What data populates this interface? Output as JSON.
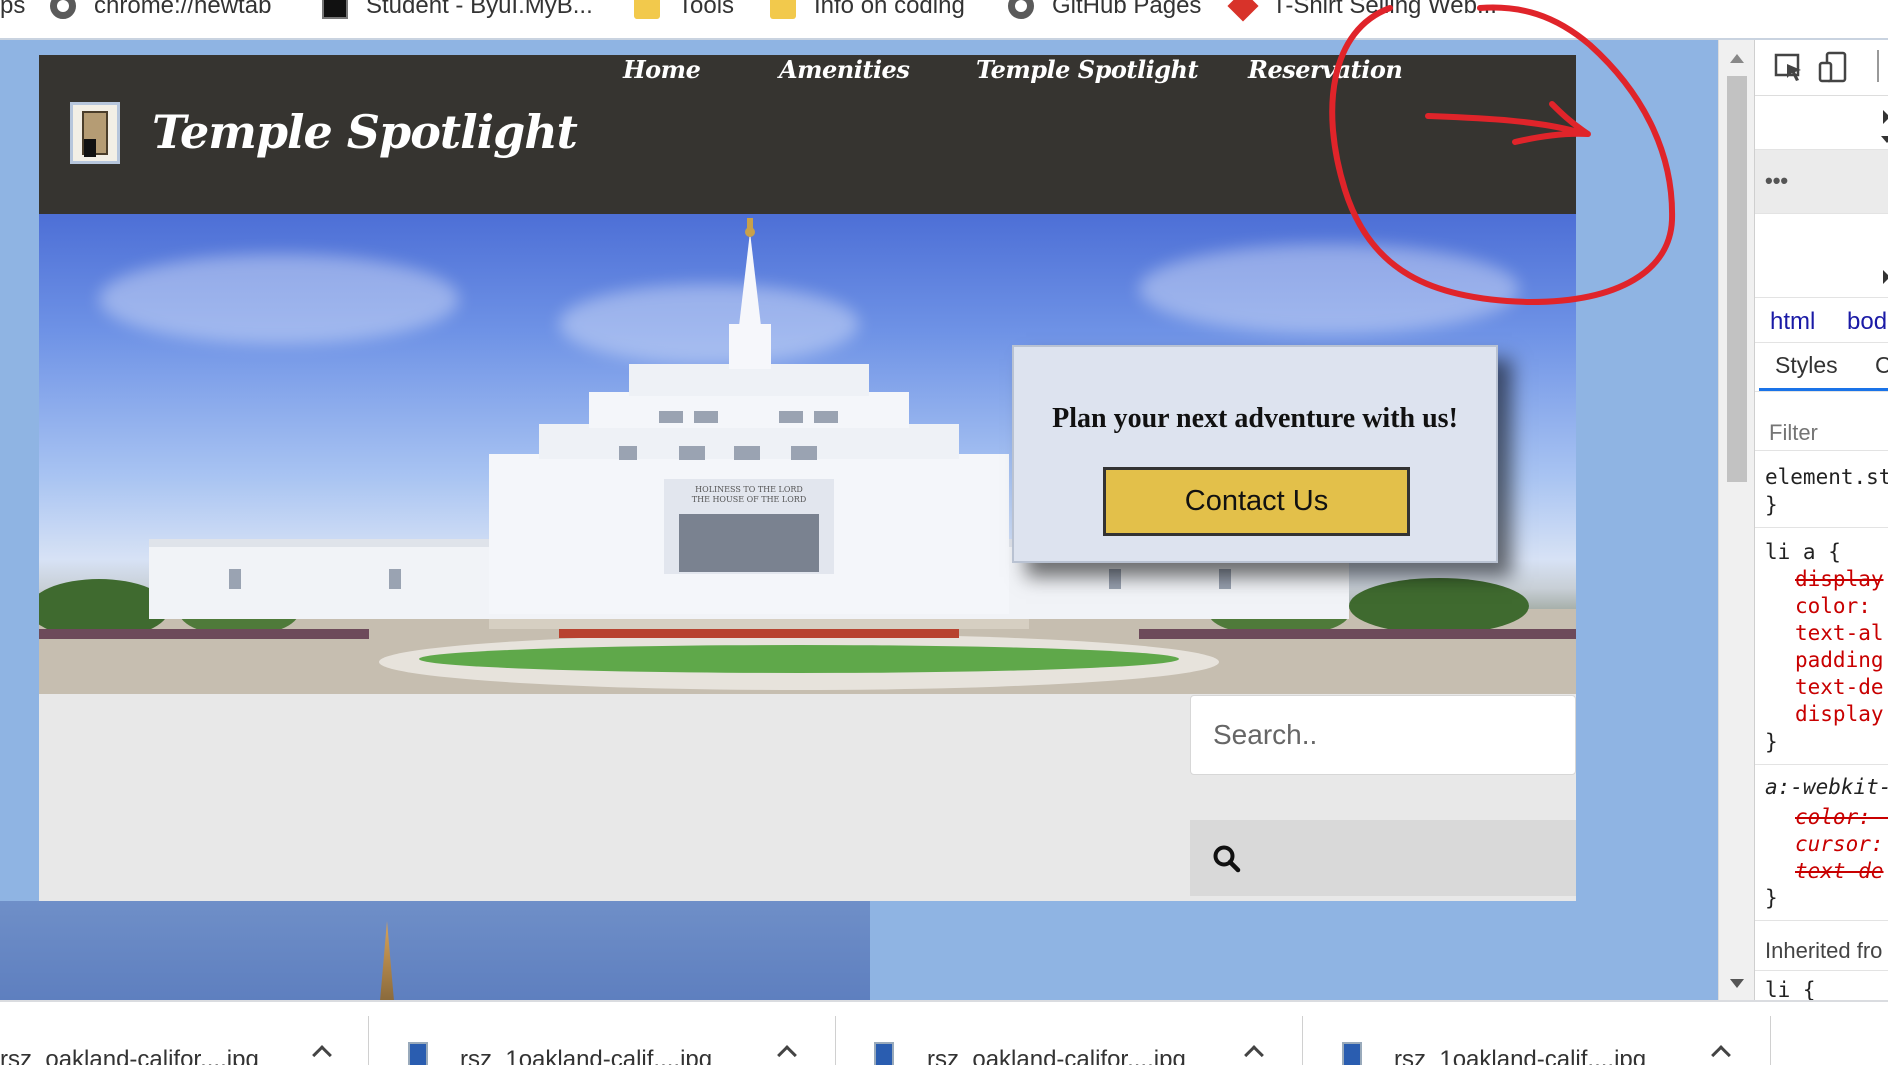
{
  "bookmarks": [
    {
      "label": "ps",
      "icon": "none"
    },
    {
      "label": "chrome://newtab",
      "icon": "globe-icon"
    },
    {
      "label": "Student - ByuI.MyB...",
      "icon": "idaho-icon"
    },
    {
      "label": "Tools",
      "icon": "folder-icon"
    },
    {
      "label": "Info on coding",
      "icon": "folder-icon"
    },
    {
      "label": "GitHub Pages",
      "icon": "globe-icon"
    },
    {
      "label": "T-Shirt Selling Web...",
      "icon": "red-diamond-icon"
    }
  ],
  "site": {
    "title": "Temple Spotlight",
    "nav": [
      "Home",
      "Amenities",
      "Temple Spotlight",
      "Reservation"
    ],
    "header_color": "#363430"
  },
  "cta": {
    "text": "Plan your next adventure with us!",
    "button_label": "Contact Us",
    "button_color": "#e3c04a"
  },
  "temple_inscription": {
    "line1": "HOLINESS TO THE LORD",
    "line2": "THE HOUSE OF THE LORD"
  },
  "search": {
    "placeholder": "Search..",
    "button_icon": "search-icon"
  },
  "devtools": {
    "breadcrumbs": [
      "html",
      "bod"
    ],
    "tabs": [
      "Styles",
      "C"
    ],
    "filter_placeholder": "Filter",
    "rules": {
      "element_style": "element.st",
      "close_brace": "}",
      "li_a_selector": "li a {",
      "li_a_props": [
        "display",
        "color:",
        "text-al",
        "padding",
        "text-de",
        "display"
      ],
      "webkit_selector": "a:-webkit-",
      "webkit_props": [
        "color: -",
        "cursor:",
        "text-de"
      ],
      "inherited_label": "Inherited fro",
      "li_partial": "li {"
    }
  },
  "downloads": [
    {
      "name": "rsz_oakland-califor....jpg"
    },
    {
      "name": "rsz_1oakland-calif....jpg"
    },
    {
      "name": "rsz_oakland-califor....jpg"
    },
    {
      "name": "rsz_1oakland-calif....jpg"
    }
  ],
  "colors": {
    "page_background": "#8fb4e3",
    "annotation": "#e0242a"
  }
}
